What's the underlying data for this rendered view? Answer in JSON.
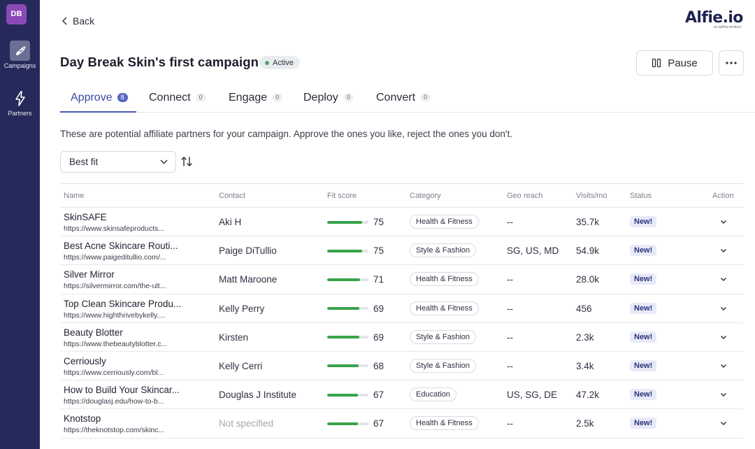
{
  "sidebar": {
    "avatar": "DB",
    "items": [
      {
        "label": "Campaigns",
        "icon": "rocket-icon"
      },
      {
        "label": "Partners",
        "icon": "lightning-icon"
      }
    ]
  },
  "header": {
    "back_label": "Back",
    "logo_text": "Alfie.io",
    "logo_sub": "an xpflow product",
    "campaign_title": "Day Break Skin's first campaign",
    "status": "Active",
    "pause_label": "Pause"
  },
  "tabs": [
    {
      "label": "Approve",
      "count": "8"
    },
    {
      "label": "Connect",
      "count": "0"
    },
    {
      "label": "Engage",
      "count": "0"
    },
    {
      "label": "Deploy",
      "count": "0"
    },
    {
      "label": "Convert",
      "count": "0"
    }
  ],
  "intro": "These are potential affiliate partners for your campaign. Approve the ones you like, reject the ones you don't.",
  "sort": {
    "selected": "Best fit"
  },
  "table": {
    "headers": [
      "Name",
      "Contact",
      "Fit score",
      "Category",
      "Geo reach",
      "Visits/mo",
      "Status",
      "Action"
    ],
    "rows": [
      {
        "name": "SkinSAFE",
        "url": "https://www.skinsafeproducts...",
        "contact": "Aki H",
        "fit": 75,
        "category": "Health & Fitness",
        "geo": "--",
        "visits": "35.7k",
        "status": "New!"
      },
      {
        "name": "Best Acne Skincare Routi...",
        "url": "https://www.paigeditullio.com/...",
        "contact": "Paige DiTullio",
        "fit": 75,
        "category": "Style & Fashion",
        "geo": "SG, US, MD",
        "visits": "54.9k",
        "status": "New!"
      },
      {
        "name": "Silver Mirror",
        "url": "https://silvermirror.com/the-ult...",
        "contact": "Matt Maroone",
        "fit": 71,
        "category": "Health & Fitness",
        "geo": "--",
        "visits": "28.0k",
        "status": "New!"
      },
      {
        "name": "Top Clean Skincare Produ...",
        "url": "https://www.highthrivebykelly....",
        "contact": "Kelly Perry",
        "fit": 69,
        "category": "Health & Fitness",
        "geo": "--",
        "visits": "456",
        "status": "New!"
      },
      {
        "name": "Beauty Blotter",
        "url": "https://www.thebeautyblotter.c...",
        "contact": "Kirsten",
        "fit": 69,
        "category": "Style & Fashion",
        "geo": "--",
        "visits": "2.3k",
        "status": "New!"
      },
      {
        "name": "Cerriously",
        "url": "https://www.cerriously.com/bl...",
        "contact": "Kelly Cerri",
        "fit": 68,
        "category": "Style & Fashion",
        "geo": "--",
        "visits": "3.4k",
        "status": "New!"
      },
      {
        "name": "How to Build Your Skincar...",
        "url": "https://douglasj.edu/how-to-b...",
        "contact": "Douglas J Institute",
        "fit": 67,
        "category": "Education",
        "geo": "US, SG, DE",
        "visits": "47.2k",
        "status": "New!"
      },
      {
        "name": "Knotstop",
        "url": "https://theknotstop.com/skinc...",
        "contact": "Not specified",
        "contact_muted": true,
        "fit": 67,
        "category": "Health & Fitness",
        "geo": "--",
        "visits": "2.5k",
        "status": "New!"
      }
    ]
  }
}
